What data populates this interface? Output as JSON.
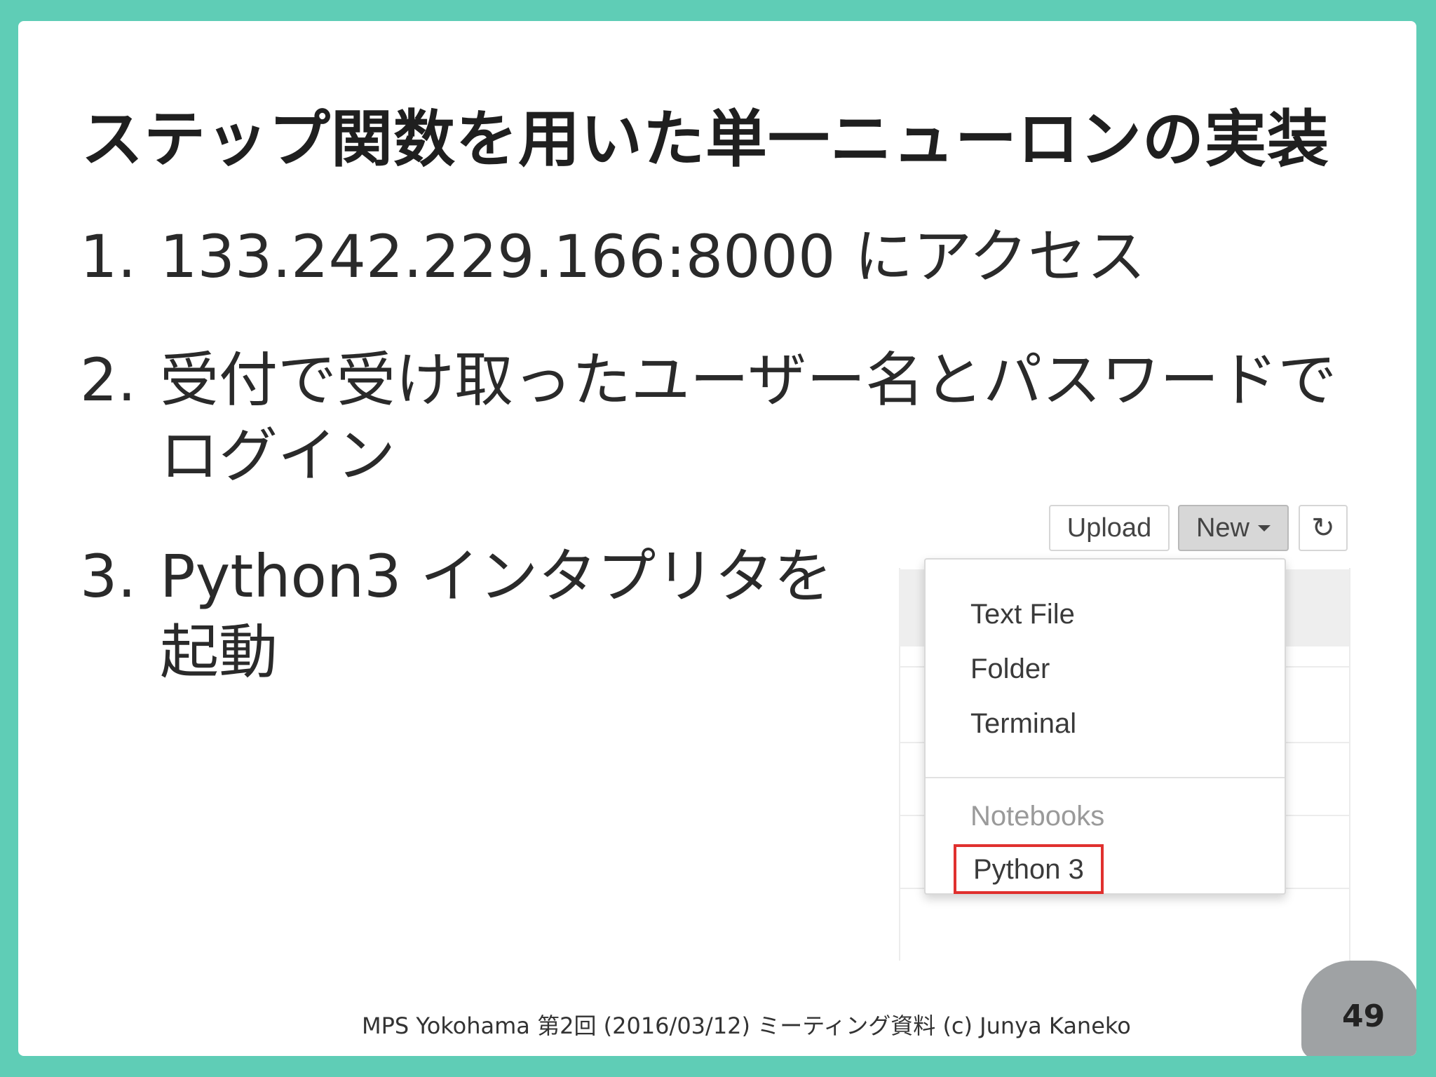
{
  "slide": {
    "title": "ステップ関数を用いた単一ニューロンの実装",
    "items": [
      {
        "num": "1.",
        "lines": [
          "133.242.229.166:8000 にアクセス"
        ]
      },
      {
        "num": "2.",
        "lines": [
          "受付で受け取ったユーザー名とパスワードで",
          "ログイン"
        ]
      },
      {
        "num": "3.",
        "lines": [
          "Python3 インタプリタを",
          "起動"
        ]
      }
    ],
    "footer": "MPS Yokohama 第2回 (2016/03/12) ミーティング資料 (c) Junya Kaneko",
    "page_number": "49"
  },
  "jupyter": {
    "upload_label": "Upload",
    "new_label": "New",
    "refresh_icon": "↻",
    "menu": {
      "text_file": "Text File",
      "folder": "Folder",
      "terminal": "Terminal",
      "notebooks_header": "Notebooks",
      "python3": "Python 3"
    }
  },
  "colors": {
    "frame": "#5fcdb6",
    "highlight": "#e0302e",
    "new_button": "#d7d7d7"
  }
}
